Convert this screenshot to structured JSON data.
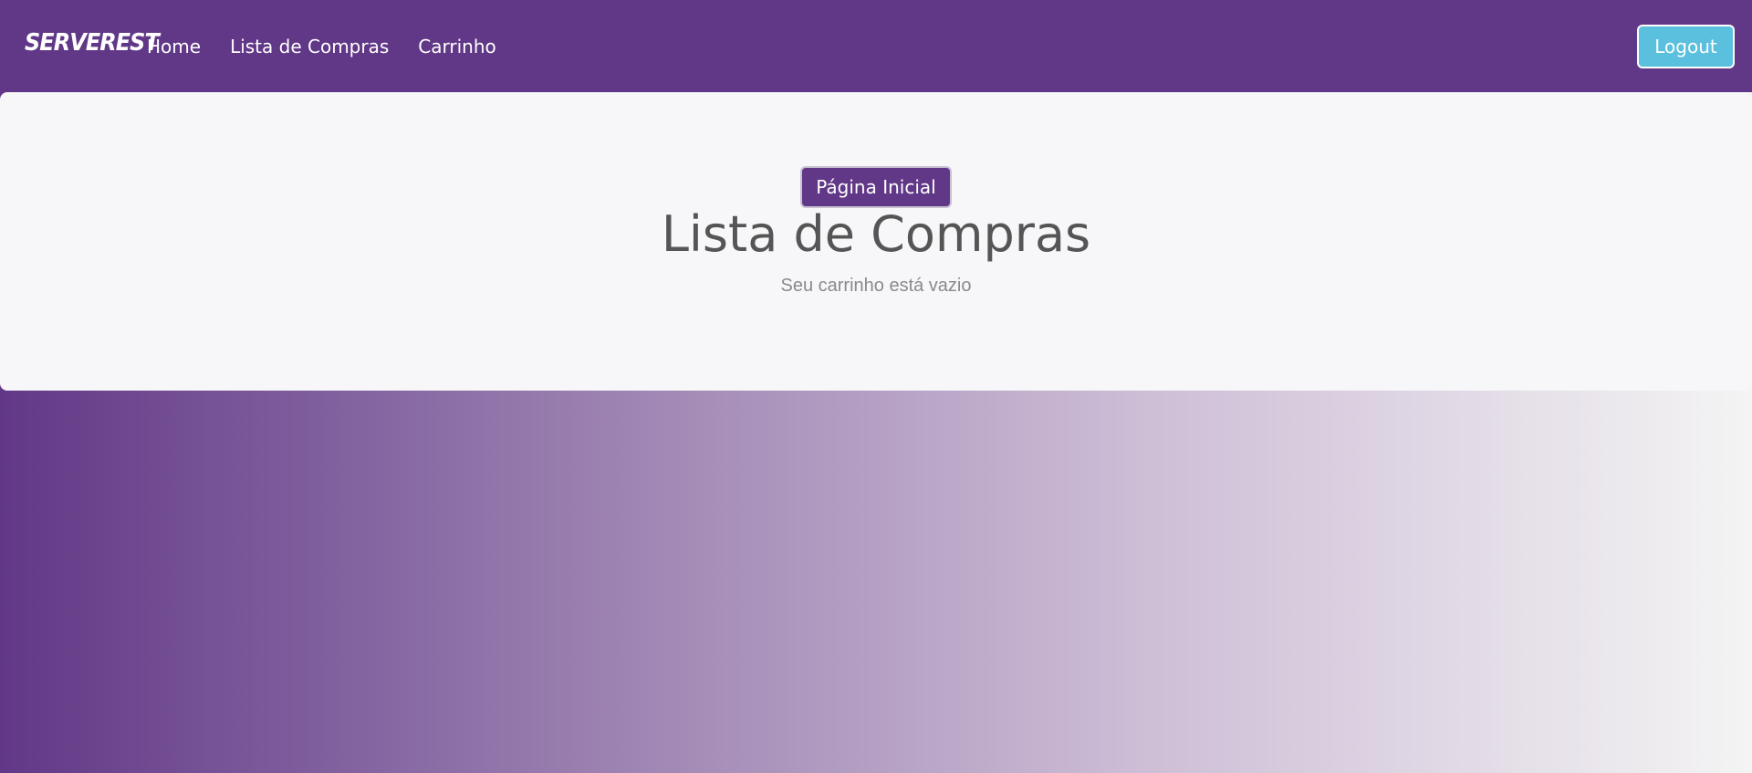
{
  "navbar": {
    "logo_text": "SERVEREST",
    "links": [
      {
        "label": "Home"
      },
      {
        "label": "Lista de Compras"
      },
      {
        "label": "Carrinho"
      }
    ],
    "logout_label": "Logout"
  },
  "main": {
    "home_button_label": "Página Inicial",
    "title": "Lista de Compras",
    "empty_message": "Seu carrinho está vazio"
  },
  "colors": {
    "brand_purple": "#613887",
    "logout_button": "#5bc0de",
    "panel_background": "#f7f6f9"
  }
}
